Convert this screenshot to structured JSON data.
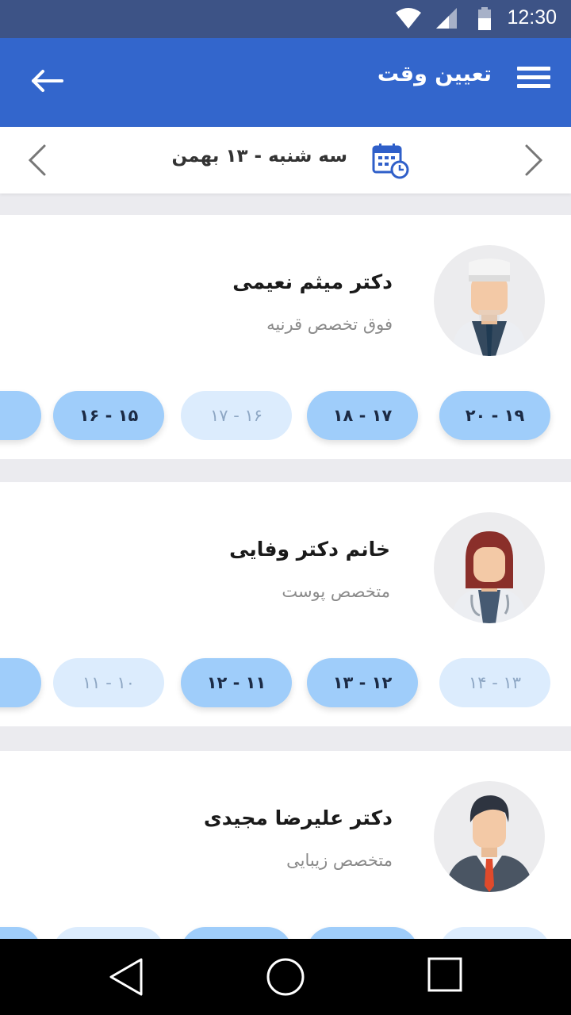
{
  "status_bar": {
    "time": "12:30"
  },
  "app_bar": {
    "title": "تعیین وقت"
  },
  "date_bar": {
    "date": "سه شنبه - ۱۳ بهمن"
  },
  "doctors": [
    {
      "name": "دکتر میثم نعیمی",
      "specialty": "فوق تخصص قرنیه",
      "avatar": "male-doctor-avatar",
      "slots": [
        {
          "label": "۲۰ - ۱۹",
          "available": true
        },
        {
          "label": "۱۸ - ۱۷",
          "available": true
        },
        {
          "label": "۱۷ - ۱۶",
          "available": false
        },
        {
          "label": "۱۶ - ۱۵",
          "available": true
        }
      ]
    },
    {
      "name": "خانم دکتر وفایی",
      "specialty": "متخصص پوست",
      "avatar": "female-doctor-avatar",
      "slots": [
        {
          "label": "۱۴ - ۱۳",
          "available": false
        },
        {
          "label": "۱۳ - ۱۲",
          "available": true
        },
        {
          "label": "۱۲ - ۱۱",
          "available": true
        },
        {
          "label": "۱۱ - ۱۰",
          "available": false
        }
      ]
    },
    {
      "name": "دکتر علیرضا مجیدی",
      "specialty": "متخصص زیبایی",
      "avatar": "businessman-avatar"
    }
  ],
  "colors": {
    "status_bar": "#3d5386",
    "app_bar": "#3366cc",
    "slot_available": "#9fcdfa",
    "slot_unavailable": "#dcecfd",
    "background": "#ebebef"
  }
}
